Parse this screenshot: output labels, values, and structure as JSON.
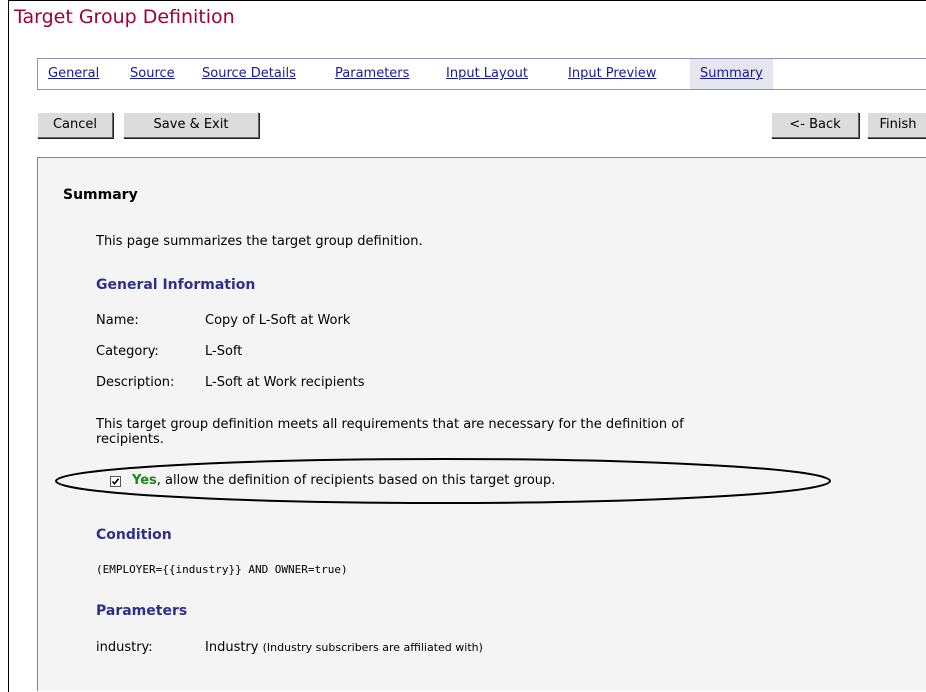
{
  "page_title": "Target Group Definition",
  "tabs": [
    {
      "label": "General"
    },
    {
      "label": "Source"
    },
    {
      "label": "Source Details"
    },
    {
      "label": "Parameters"
    },
    {
      "label": "Input Layout"
    },
    {
      "label": "Input Preview"
    },
    {
      "label": "Summary",
      "active": true
    }
  ],
  "buttons": {
    "cancel": "Cancel",
    "save_exit": "Save & Exit",
    "back": "<- Back",
    "finish": "Finish"
  },
  "summary": {
    "heading": "Summary",
    "intro": "This page summarizes the target group definition.",
    "general_info": {
      "heading": "General Information",
      "name_label": "Name:",
      "name_value": "Copy of L-Soft at Work",
      "category_label": "Category:",
      "category_value": "L-Soft",
      "description_label": "Description:",
      "description_value": "L-Soft at Work recipients"
    },
    "requirements_line1": "This target group definition meets all requirements that are necessary for the definition of",
    "requirements_line2": "recipients.",
    "allow_checkbox": {
      "checked": true,
      "yes_label": "Yes",
      "rest_label": ", allow the definition of recipients based on this target group."
    },
    "condition": {
      "heading": "Condition",
      "expression": "(EMPLOYER={{industry}} AND OWNER=true)"
    },
    "parameters": {
      "heading": "Parameters",
      "name": "industry:",
      "label": "Industry",
      "description": "(Industry subscribers are affiliated with)"
    }
  }
}
